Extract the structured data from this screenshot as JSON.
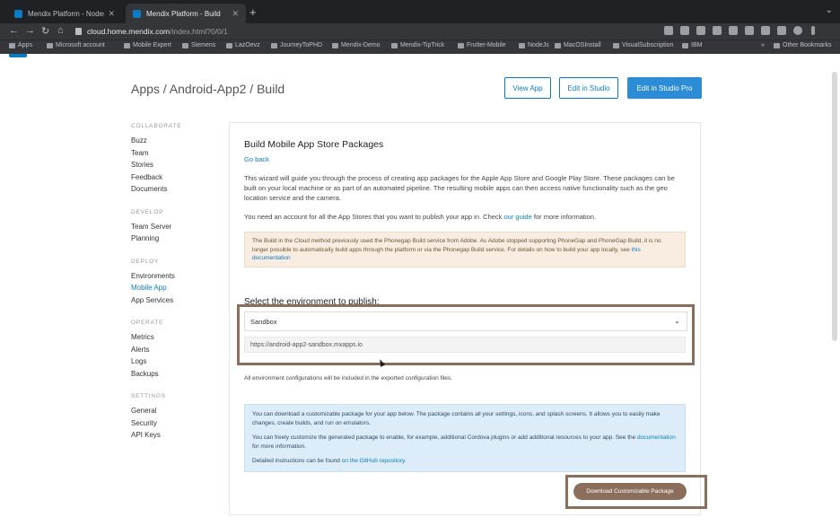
{
  "browser": {
    "tabs": [
      {
        "label": "Mendix Platform - Nodes",
        "close": "✕"
      },
      {
        "label": "Mendix Platform - Build",
        "close": "✕"
      }
    ],
    "newtab": "+",
    "window_controls": "⌄",
    "url_host": "cloud.home.mendix.com",
    "url_path": "/index.html?0/0/1",
    "bookmarks": [
      "Apps",
      "Microsoft account",
      "Mobile Expert",
      "Siemens",
      "LazOevz",
      "JourneyToPHD",
      "Mendix-Demo",
      "Mendix-TipTrick",
      "Frutter-Mobile",
      "NodeJs",
      "MacOSInstall",
      "VisualSubscription",
      "IBM"
    ],
    "bookmarks_more": "»",
    "other_bookmarks": "Other Bookmarks"
  },
  "header": {
    "breadcrumb": "Apps / Android-App2 / Build",
    "buttons": {
      "view_app": "View App",
      "edit_studio": "Edit in Studio",
      "edit_studio_pro": "Edit in Studio Pro"
    }
  },
  "sidebar": {
    "sections": [
      {
        "title": "COLLABORATE",
        "items": [
          "Buzz",
          "Team",
          "Stories",
          "Feedback",
          "Documents"
        ]
      },
      {
        "title": "DEVELOP",
        "items": [
          "Team Server",
          "Planning"
        ]
      },
      {
        "title": "DEPLOY",
        "items": [
          "Environments",
          "Mobile App",
          "App Services"
        ]
      },
      {
        "title": "OPERATE",
        "items": [
          "Metrics",
          "Alerts",
          "Logs",
          "Backups"
        ]
      },
      {
        "title": "SETTINGS",
        "items": [
          "General",
          "Security",
          "API Keys"
        ]
      }
    ],
    "active": "Mobile App"
  },
  "main": {
    "title": "Build Mobile App Store Packages",
    "go_back": "Go back",
    "intro": "This wizard will guide you through the process of creating app packages for the Apple App Store and Google Play Store. These packages can be built on your local machine or as part of an automated pipeline. The resulting mobile apps can then access native functionality such as the geo location service and the camera.",
    "account_pre": "You need an account for all the App Stores that you want to publish your app in. Check ",
    "account_link": "our guide",
    "account_post": " for more information.",
    "warning_text": "The Build in the Cloud method previously used the Phonegap Build service from Adobe. As Adobe stopped supporting PhoneGap and PhoneGap Build, it is no longer possible to automatically build apps through the platform or via the Phonegap Build service. For details on how to build your app locally, see ",
    "warning_link": "this documentation",
    "select_label": "Select the environment to publish:",
    "select_value": "Sandbox",
    "env_url": "https://android-app2-sandbox.mxapps.io",
    "config_note": "All environment configurations will be included in the exported configuration files.",
    "info_p1": "You can download a customizable package for your app below. The package contains all your settings, icons, and splash screens. It allows you to easily make changes, create builds, and run on emulators.",
    "info_p2_pre": "You can freely customize the generated package to enable, for example, additional Cordova plugins or add additional resources to your app. See the ",
    "info_p2_link": "documentation",
    "info_p2_post": " for more information.",
    "info_p3_pre": "Detailed instructions can be found ",
    "info_p3_link": "on the GitHub repository",
    "info_p3_post": ".",
    "download_button": "Download Customizable Package"
  },
  "colors": {
    "accent": "#0a7cc4",
    "highlight_box": "#8b6f5c",
    "warning_bg": "#f8ede0",
    "info_bg": "#dcedf9"
  }
}
